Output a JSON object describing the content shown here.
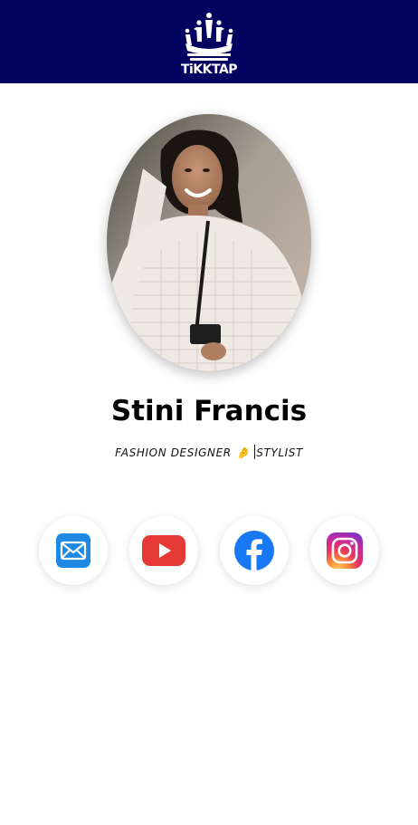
{
  "header": {
    "brand_name": "TiKKTAP",
    "background_color": "#050360",
    "logo_icon": "crown-logo-icon"
  },
  "profile": {
    "avatar_icon": "profile-photo",
    "name": "Stini Francis",
    "role_primary": "FASHION DESIGNER",
    "role_emoji": "🤌",
    "role_secondary": "STYLIST"
  },
  "socials": [
    {
      "label": "Email",
      "icon": "email-icon",
      "color": "#1E88E5"
    },
    {
      "label": "YouTube",
      "icon": "youtube-icon",
      "color": "#E53935"
    },
    {
      "label": "Facebook",
      "icon": "facebook-icon",
      "color": "#1877F2"
    },
    {
      "label": "Instagram",
      "icon": "instagram-icon",
      "color": "#D6249F"
    }
  ]
}
